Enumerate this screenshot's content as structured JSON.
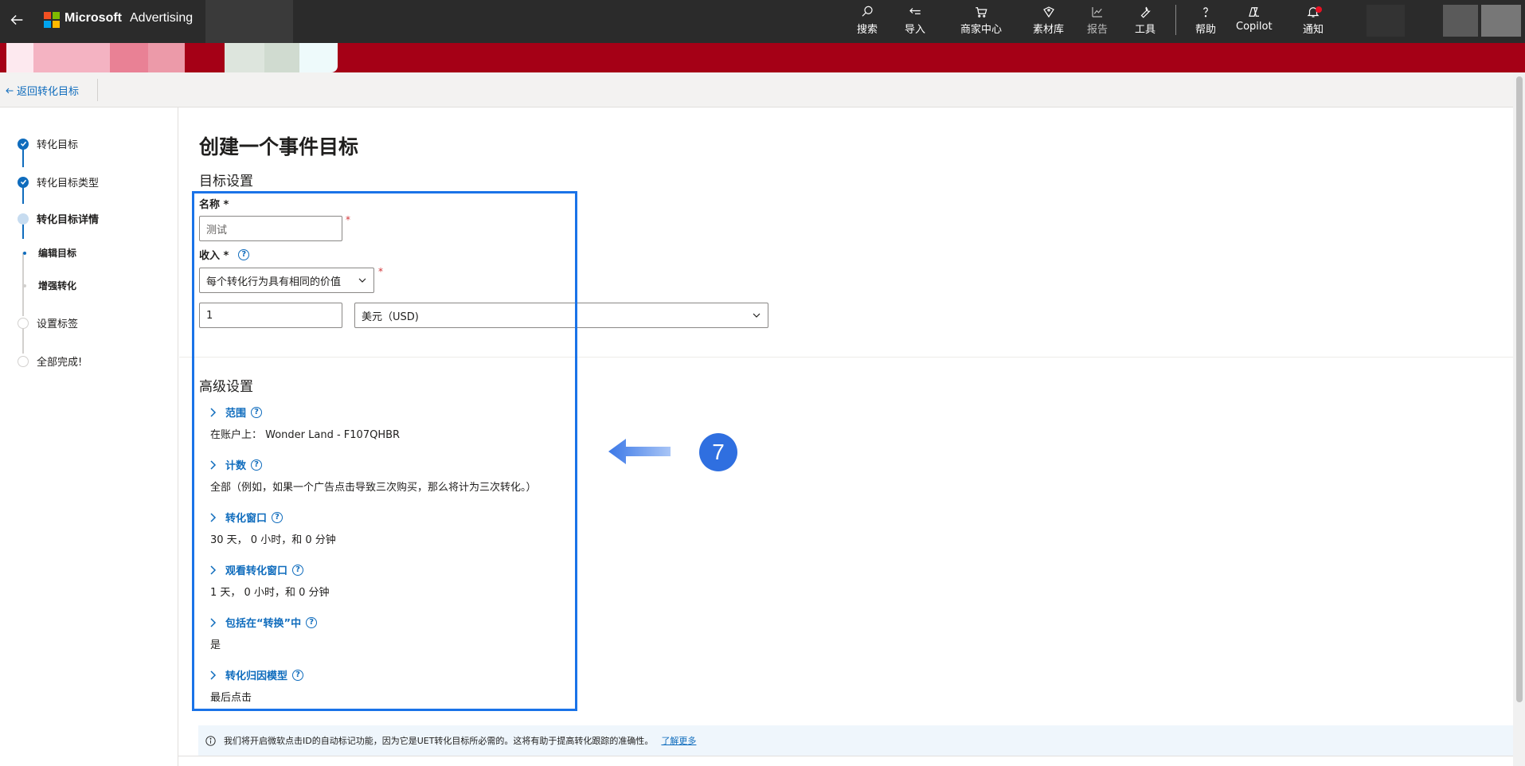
{
  "topbar": {
    "brand_name": "Microsoft",
    "brand_product": "Advertising",
    "nav": [
      {
        "label": "搜索",
        "icon": "search-icon"
      },
      {
        "label": "导入",
        "icon": "import-icon"
      },
      {
        "label": "商家中心",
        "icon": "cart-icon"
      },
      {
        "label": "素材库",
        "icon": "tag-icon"
      },
      {
        "label": "报告",
        "icon": "chart-icon"
      },
      {
        "label": "工具",
        "icon": "wrench-icon"
      },
      {
        "label": "帮助",
        "icon": "help-icon"
      },
      {
        "label": "Copilot",
        "icon": "copilot-icon"
      },
      {
        "label": "通知",
        "icon": "bell-icon"
      }
    ],
    "logo_colors": [
      "#f25022",
      "#7fba00",
      "#00a4ef",
      "#ffb900"
    ]
  },
  "back_link": "返回转化目标",
  "steps": [
    {
      "label": "转化目标",
      "state": "done"
    },
    {
      "label": "转化目标类型",
      "state": "done"
    },
    {
      "label": "转化目标详情",
      "state": "current"
    },
    {
      "label": "编辑目标",
      "state": "sub-active"
    },
    {
      "label": "增强转化",
      "state": "sub"
    },
    {
      "label": "设置标签",
      "state": "todo"
    },
    {
      "label": "全部完成!",
      "state": "todo"
    }
  ],
  "main": {
    "page_title": "创建一个事件目标",
    "section_title": "目标设置",
    "name_label": "名称 *",
    "name_value": "测试",
    "revenue_label": "收入 *",
    "revenue_type": "每个转化行为具有相同的价值",
    "revenue_amount": "1",
    "currency": "美元（USD)",
    "required_mark": "*",
    "help_glyph": "?",
    "advanced_title": "高级设置",
    "advanced": [
      {
        "title": "范围",
        "value": "在账户上： Wonder Land - F107QHBR"
      },
      {
        "title": "计数",
        "value": "全部（例如，如果一个广告点击导致三次购买，那么将计为三次转化。）"
      },
      {
        "title": "转化窗口",
        "value": "30 天， 0 小时，和 0 分钟"
      },
      {
        "title": "观看转化窗口",
        "value": "1 天， 0 小时，和 0 分钟"
      },
      {
        "title": "包括在“转换”中",
        "value": "是"
      },
      {
        "title": "转化归因模型",
        "value": "最后点击"
      }
    ]
  },
  "annotation": {
    "step_number": "7"
  },
  "infobar": {
    "text": "我们将开启微软点击ID的自动标记功能，因为它是UET转化目标所必需的。这将有助于提高转化跟踪的准确性。",
    "link": "了解更多"
  },
  "colors": {
    "accent": "#0f6cbd",
    "banner": "#a50016",
    "highlight": "#1a73e8",
    "badge": "#2f6fe0"
  }
}
